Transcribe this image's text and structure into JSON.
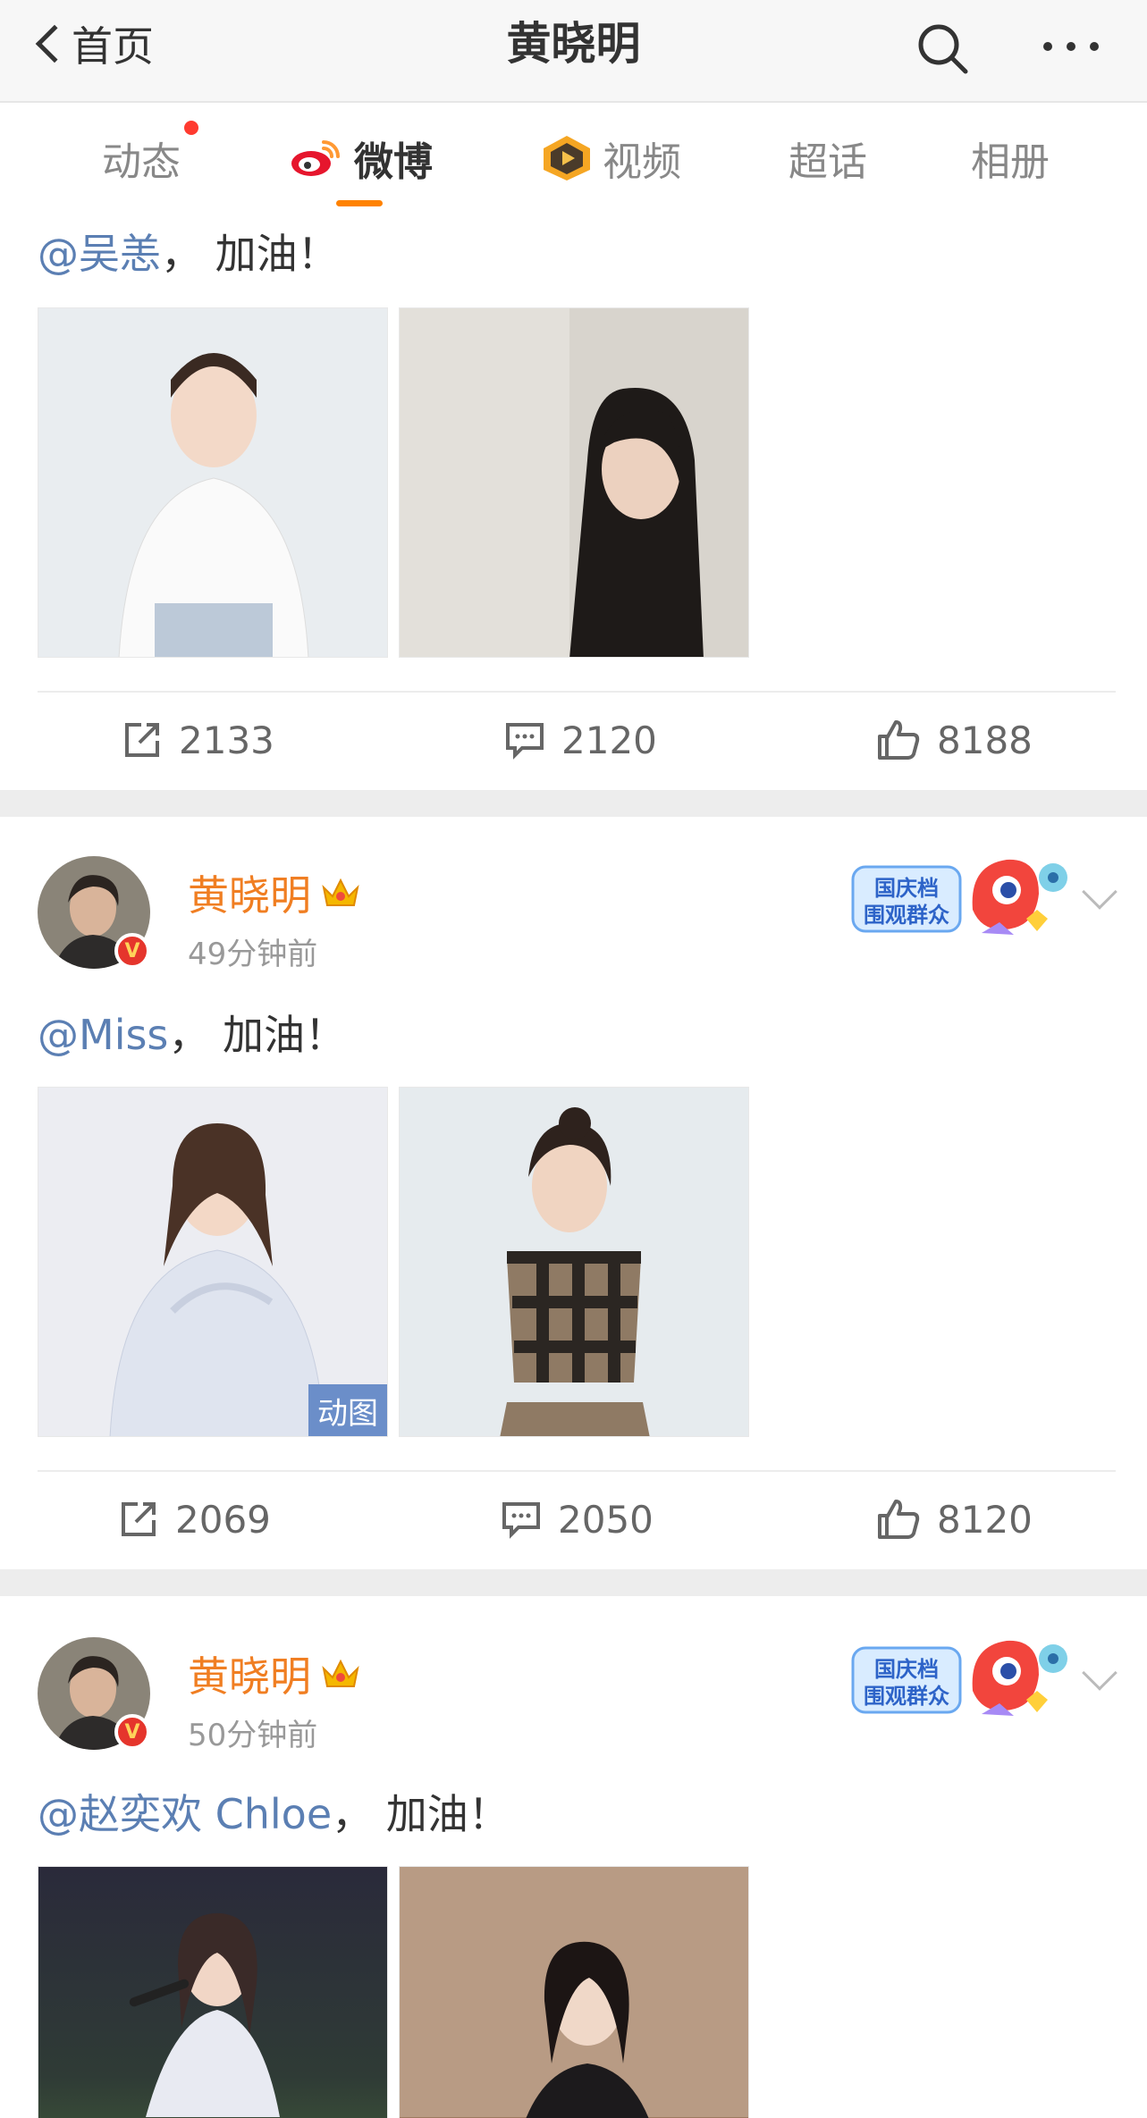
{
  "nav": {
    "back_label": "首页",
    "title": "黄晓明"
  },
  "tabs": [
    {
      "label": "动态",
      "has_dot": true
    },
    {
      "label": "微博",
      "active": true
    },
    {
      "label": "视频"
    },
    {
      "label": "超话"
    },
    {
      "label": "相册"
    }
  ],
  "colors": {
    "accent": "#ff8200",
    "username": "#f07e22",
    "mention": "#5b7fb3",
    "badge_red": "#e5352c"
  },
  "posts": [
    {
      "mention": "@吴恙",
      "text_suffix": "， 加油！",
      "stats": {
        "repost": "2133",
        "comment": "2120",
        "like": "8188"
      }
    },
    {
      "username": "黄晓明",
      "time": "49分钟前",
      "mention": "@Miss",
      "text_suffix": "， 加油！",
      "gif_label": "动图",
      "stats": {
        "repost": "2069",
        "comment": "2050",
        "like": "8120"
      }
    },
    {
      "username": "黄晓明",
      "time": "50分钟前",
      "mention": "@赵奕欢 Chloe",
      "text_suffix": "， 加油！"
    }
  ],
  "event_badge": {
    "line1": "国庆档",
    "line2": "围观群众"
  },
  "verified_badge": "V",
  "icons": [
    "search-icon",
    "more-icon",
    "repost-icon",
    "comment-icon",
    "like-icon",
    "crown-icon",
    "chevron-down-icon"
  ]
}
